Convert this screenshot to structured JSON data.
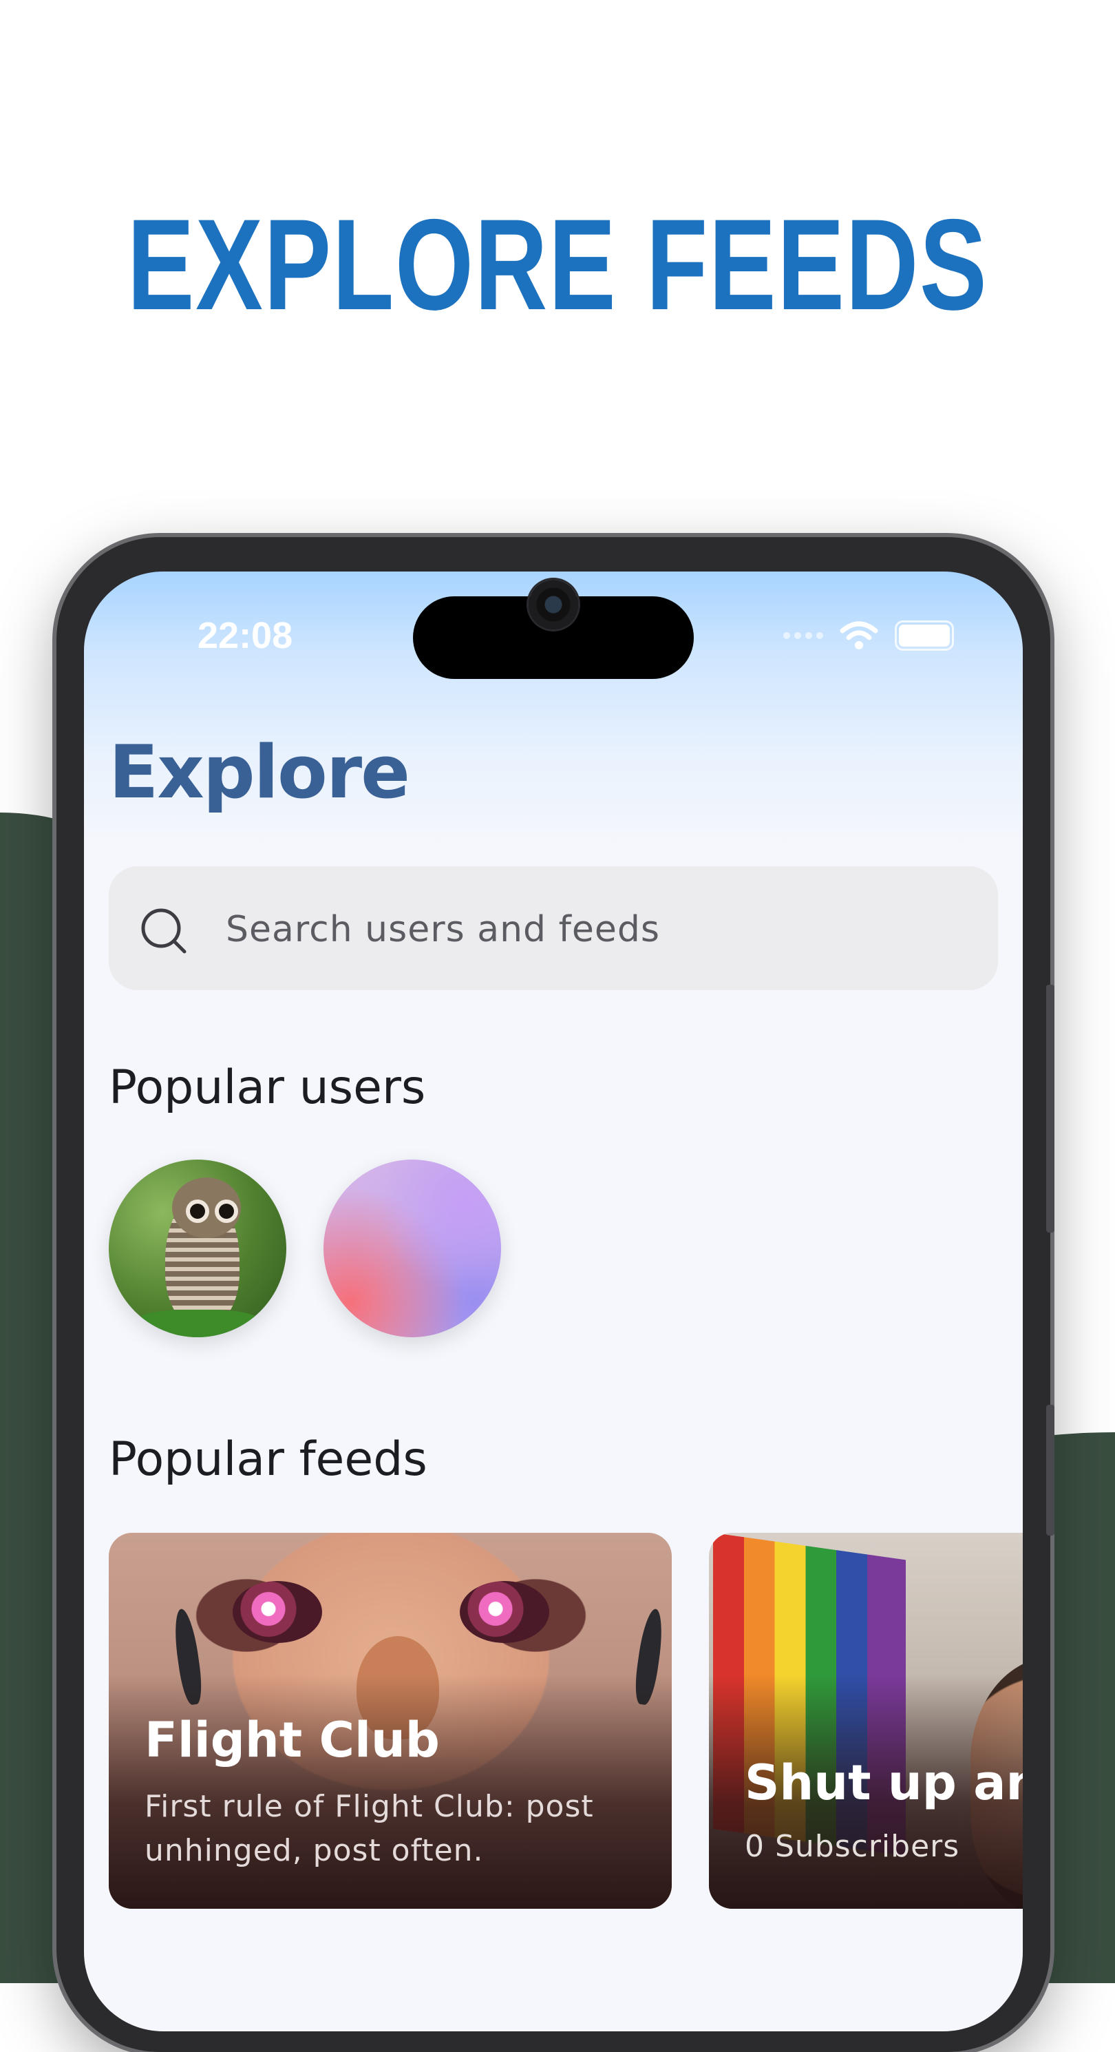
{
  "promo": {
    "headline": "EXPLORE FEEDS"
  },
  "status_bar": {
    "time": "22:08"
  },
  "explore": {
    "title": "Explore",
    "search": {
      "placeholder": "Search users and feeds"
    },
    "popular_users": {
      "title": "Popular users"
    },
    "popular_feeds": {
      "title": "Popular feeds",
      "feeds": [
        {
          "title": "Flight Club",
          "description": "First rule of Flight Club: post unhinged, post often."
        },
        {
          "title": "Shut up and",
          "subtitle": "0 Subscribers"
        }
      ]
    }
  },
  "colors": {
    "headline": "#1d72bf",
    "title": "#3a6196",
    "background_shape": "#3a4e40"
  }
}
